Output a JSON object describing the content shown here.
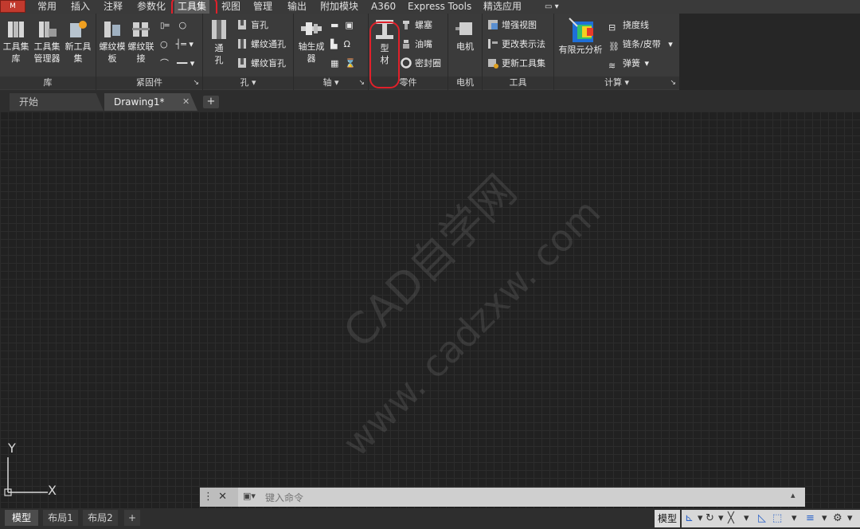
{
  "app_button": "M",
  "menu_tabs": [
    "常用",
    "插入",
    "注释",
    "参数化",
    "工具集",
    "视图",
    "管理",
    "输出",
    "附加模块",
    "A360",
    "Express Tools",
    "精选应用"
  ],
  "highlight_color": "#e0202a",
  "ribbon": {
    "library": {
      "title": "库",
      "buttons": [
        "工具集库",
        "工具集管理器",
        "新工具集"
      ]
    },
    "fasteners": {
      "title": "紧固件",
      "buttons": [
        "螺纹模板",
        "螺纹联接"
      ]
    },
    "holes": {
      "title": "孔",
      "buttons": [
        "通孔"
      ],
      "rows": [
        "盲孔",
        "螺纹通孔",
        "螺纹盲孔"
      ]
    },
    "shaft": {
      "title": "轴",
      "buttons": [
        "轴生成器"
      ]
    },
    "parts": {
      "title": "零件",
      "highlight_button": "型材",
      "rows": [
        "螺塞",
        "油嘴",
        "密封圈"
      ]
    },
    "motor": {
      "title": "电机",
      "buttons": [
        "电机"
      ]
    },
    "tools": {
      "title": "工具",
      "rows": [
        "增强视图",
        "更改表示法",
        "更新工具集"
      ]
    },
    "calc": {
      "title": "计算",
      "buttons": [
        "有限元分析"
      ],
      "rows": [
        "挠度线",
        "链条/皮带",
        "弹簧"
      ]
    }
  },
  "file_tabs": {
    "start": "开始",
    "doc": "Drawing1*",
    "add": "+"
  },
  "watermark": {
    "line1": "CAD自学网",
    "line2": "www. cadzxw. com"
  },
  "ucs": {
    "x": "X",
    "y": "Y"
  },
  "command": {
    "placeholder": "键入命令"
  },
  "layout_tabs": [
    "模型",
    "布局1",
    "布局2",
    "+"
  ],
  "status": {
    "model": "模型"
  }
}
